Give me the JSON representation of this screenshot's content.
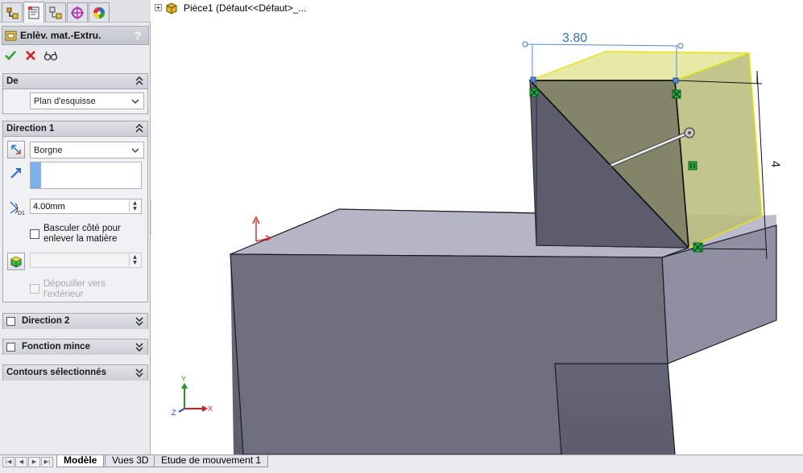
{
  "tree": {
    "part_label": "Pièce1  (Défaut<<Défaut>_..."
  },
  "property_manager": {
    "title": "Enlèv. mat.-Extru.",
    "help": "?",
    "ok_icon": "check-icon",
    "cancel_icon": "close-icon",
    "preview_icon": "glasses-icon"
  },
  "from_group": {
    "title": "De",
    "start_condition": "Plan d'esquisse"
  },
  "direction1": {
    "title": "Direction 1",
    "end_condition": "Borgne",
    "depth_value": "4.00mm",
    "flip_label": "Basculer côté pour enlever la matière",
    "flip_line1": "Basculer côté pour",
    "flip_line2": "enlever la matière",
    "draft_outward_line1": "Dépouiller vers",
    "draft_outward_line2": "l'extérieur"
  },
  "direction2": {
    "title": "Direction 2"
  },
  "thin_feature": {
    "title": "Fonction mince"
  },
  "selected_contours": {
    "title": "Contours sélectionnés"
  },
  "graphics": {
    "dimension_width": "3.80",
    "dimension_height": "4",
    "triad": {
      "x": "X",
      "y": "Y",
      "z": "Z"
    }
  },
  "tabs": {
    "model": "Modèle",
    "views3d": "Vues 3D",
    "motion": "Etude de mouvement 1"
  },
  "colors": {
    "accent_blue": "#3b78d8",
    "body_face_top": "#b7b9c7",
    "body_face_front": "#6f7180",
    "preview_yellow": "#e5e878",
    "ok_green": "#2fa52f",
    "cancel_red": "#d12020"
  }
}
